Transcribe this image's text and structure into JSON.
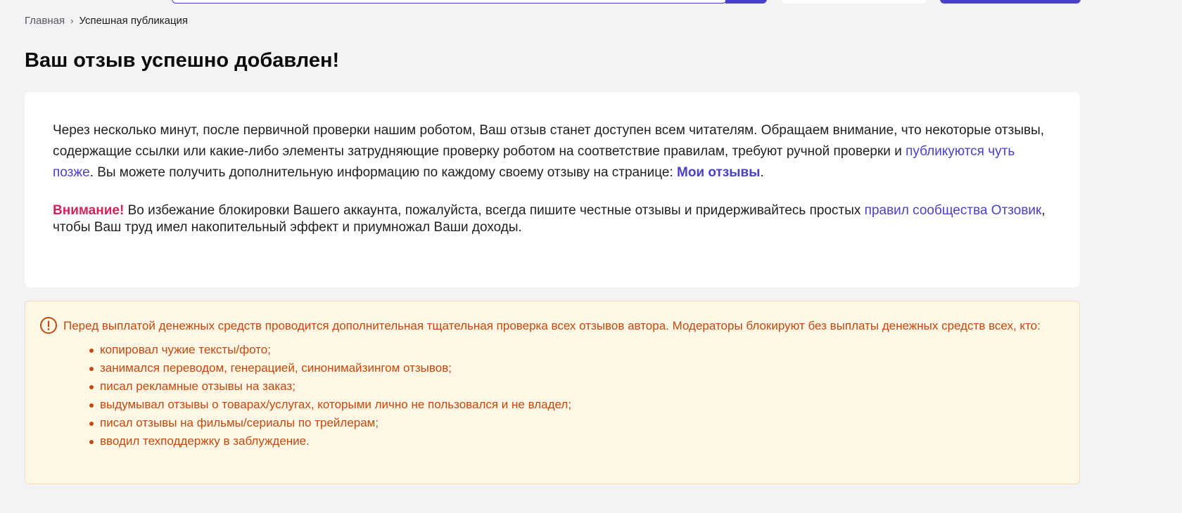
{
  "header": {},
  "breadcrumb": {
    "home": "Главная",
    "separator": "›",
    "current": "Успешная публикация"
  },
  "title": "Ваш отзыв успешно добавлен!",
  "notice": {
    "p1_text_1": "Через несколько минут, после первичной проверки нашим роботом, Ваш отзыв станет доступен всем читателям. Обращаем внимание, что некоторые отзывы, содержащие ссылки или какие-либо элементы затрудняющие проверку роботом на соответствие правилам, требуют ручной проверки и ",
    "p1_link_later": "публикуются чуть позже",
    "p1_text_2": ". Вы можете получить дополнительную информацию по каждому своему отзыву на странице: ",
    "p1_link_my_reviews": "Мои отзывы",
    "p1_text_3": ".",
    "attention_label": "Внимание!",
    "p2_text_1": " Во избежание блокировки Вашего аккаунта, пожалуйста, всегда пишите честные отзывы и придерживайтесь простых ",
    "p2_link_rules": "правил сообщества Отзовик",
    "p2_text_2": ", чтобы Ваш труд имел накопительный эффект и приумножал Ваши доходы."
  },
  "warning": {
    "icon": "exclamation-circle-icon",
    "text": "Перед выплатой денежных средств проводится дополнительная тщательная проверка всех отзывов автора. Модераторы блокируют без выплаты денежных средств всех, кто:",
    "items": [
      "копировал чужие тексты/фото;",
      "занимался переводом, генерацией, синонимайзингом отзывов;",
      "писал рекламные отзывы на заказ;",
      "выдумывал отзывы о товарах/услугах, которыми лично не пользовался и не владел;",
      "писал отзывы на фильмы/сериалы по трейлерам;",
      "вводил техподдержку в заблуждение."
    ]
  },
  "colors": {
    "accent": "#4a40c8",
    "attention": "#d0245a",
    "warning_text": "#c2490e",
    "warning_bg": "#fff7e6",
    "page_bg": "#f3f3f6"
  }
}
